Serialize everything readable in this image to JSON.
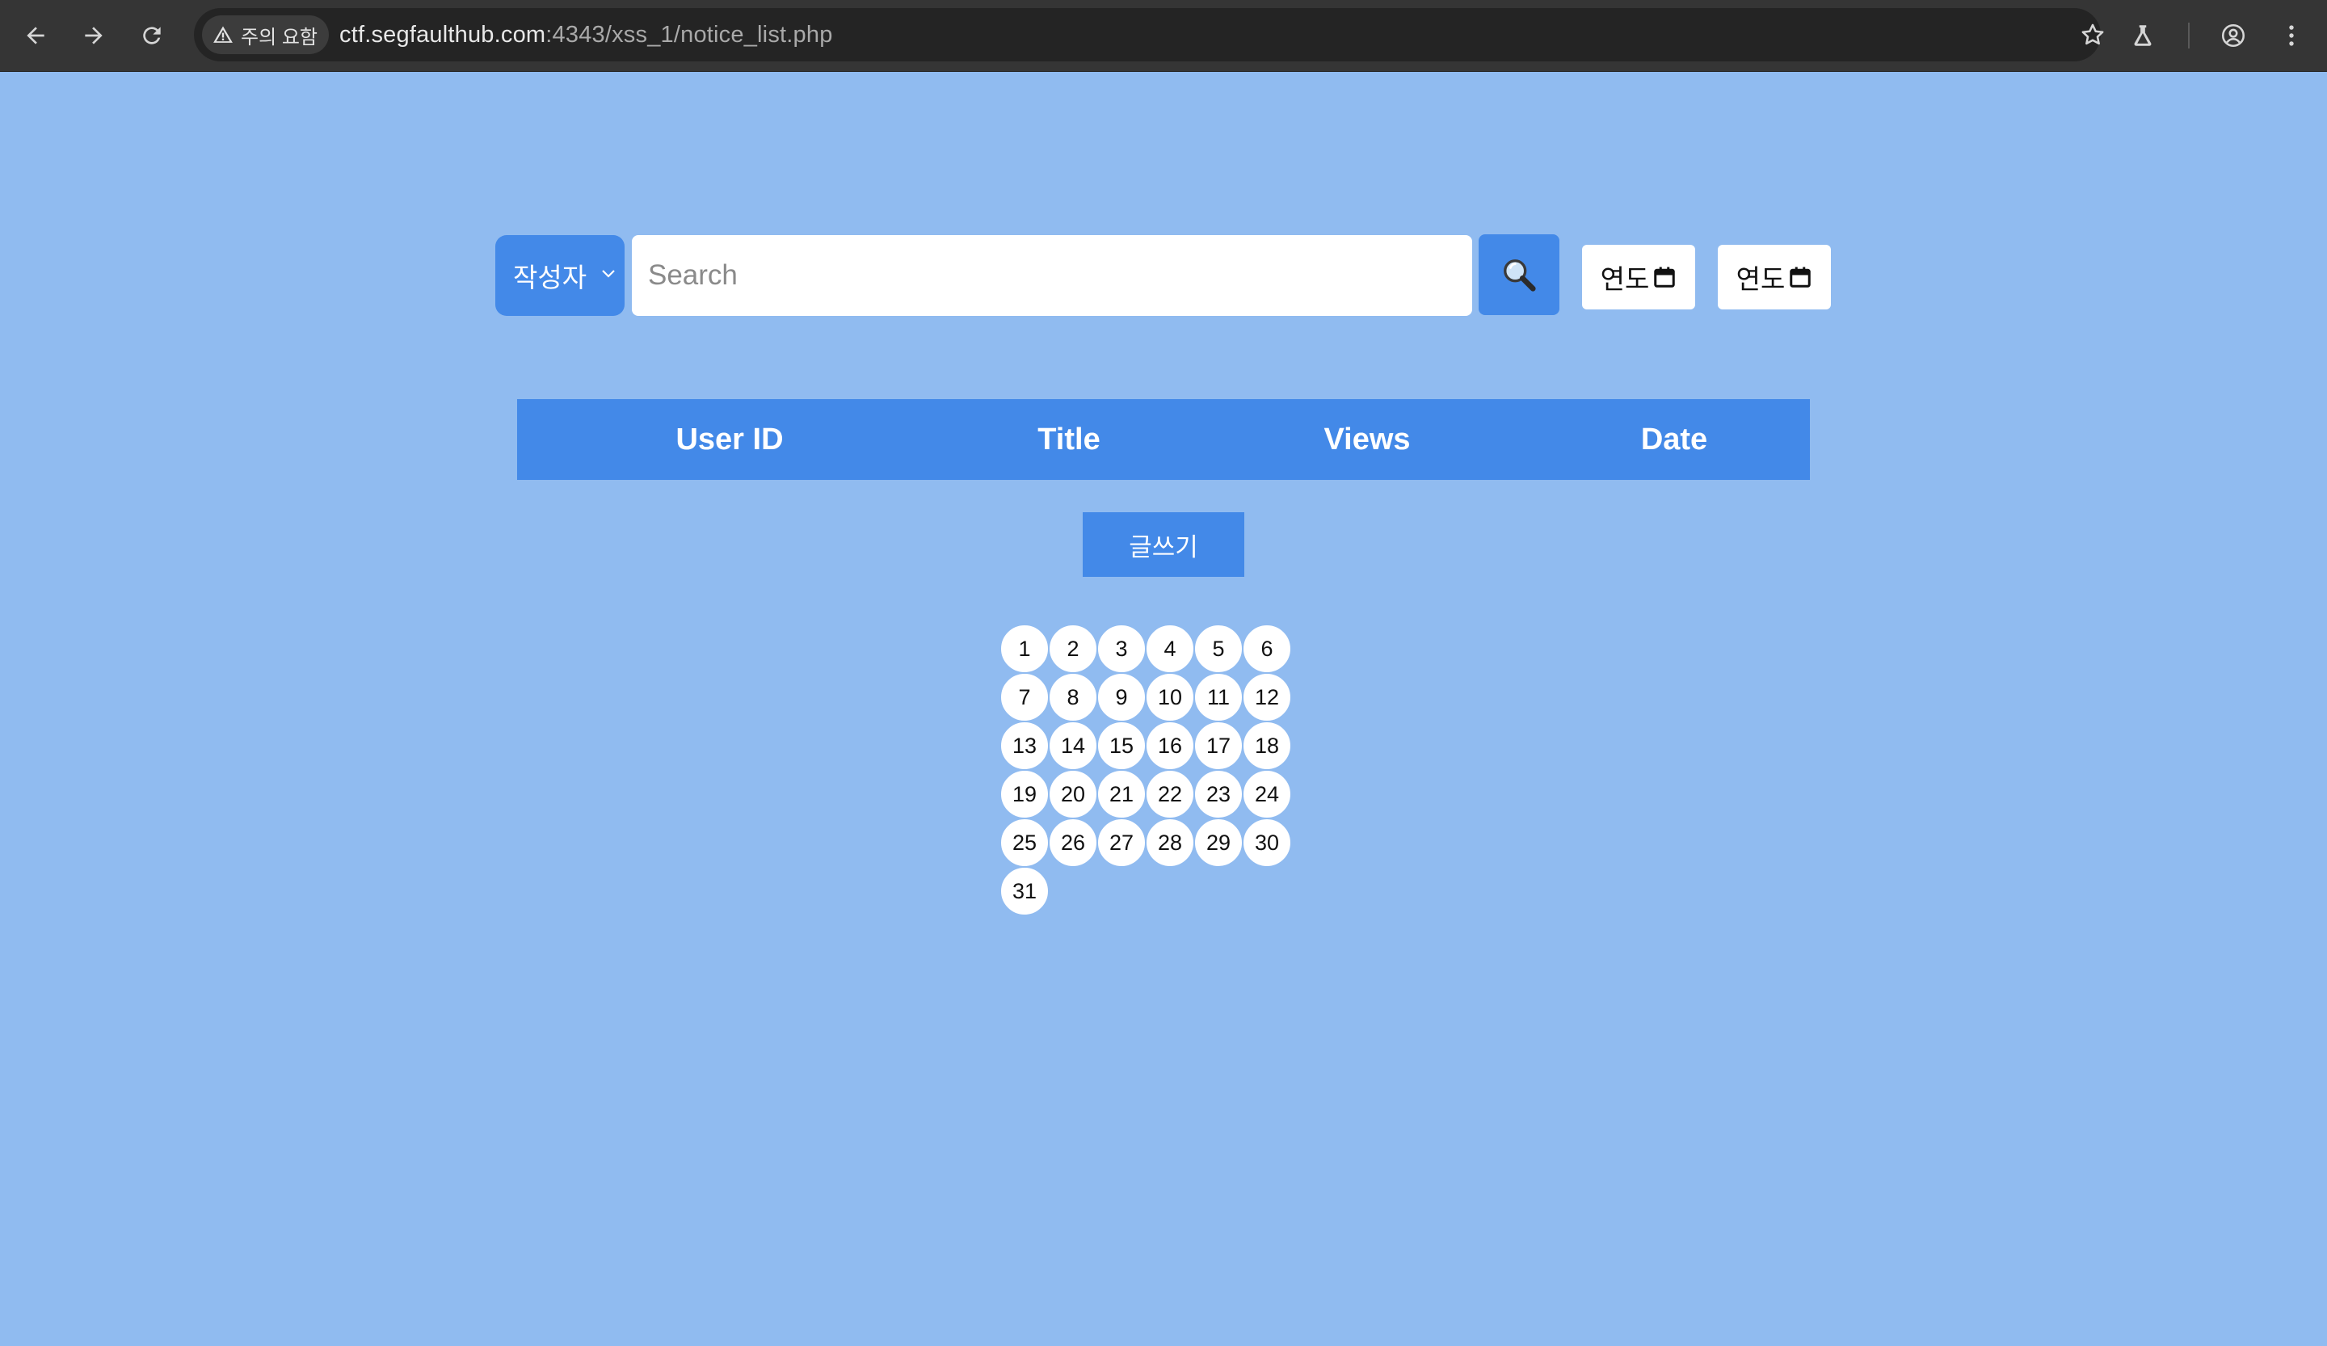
{
  "browser": {
    "security_chip": "주의 요함",
    "url_host": "ctf.segfaulthub.com",
    "url_rest": ":4343/xss_1/notice_list.php"
  },
  "search": {
    "filter_selected": "작성자",
    "placeholder": "Search",
    "year_button_1": "연도",
    "year_button_2": "연도"
  },
  "table": {
    "columns": [
      "User ID",
      "Title",
      "Views",
      "Date"
    ]
  },
  "write_button": "글쓰기",
  "days": [
    "1",
    "2",
    "3",
    "4",
    "5",
    "6",
    "7",
    "8",
    "9",
    "10",
    "11",
    "12",
    "13",
    "14",
    "15",
    "16",
    "17",
    "18",
    "19",
    "20",
    "21",
    "22",
    "23",
    "24",
    "25",
    "26",
    "27",
    "28",
    "29",
    "30",
    "31"
  ],
  "colors": {
    "page_bg": "#90bbf0",
    "accent": "#4389e8"
  }
}
